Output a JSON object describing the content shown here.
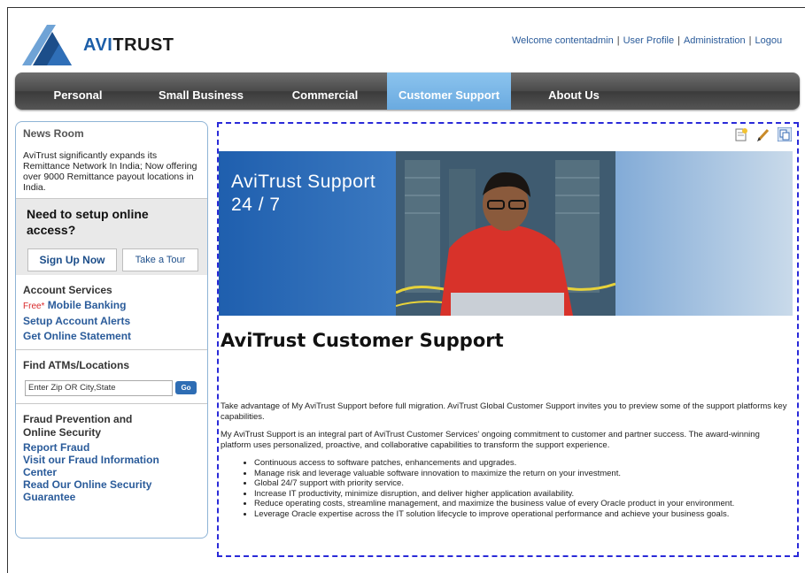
{
  "header": {
    "logo_text_av": "AVI",
    "logo_text_rest": "TRUST",
    "welcome": "Welcome contentadmin",
    "links": [
      "User Profile",
      "Administration",
      "Logou"
    ]
  },
  "nav": {
    "items": [
      "Personal",
      "Small Business",
      "Commercial",
      "Customer Support",
      "About Us"
    ],
    "active": "Customer Support"
  },
  "sidebar": {
    "newsroom": {
      "title": "News Room",
      "text": "AviTrust significantly expands its Remittance Network In India; Now offering over 9000 Remittance payout locations in India."
    },
    "setup": {
      "title": "Need to setup online access?",
      "signup_label": "Sign Up Now",
      "tour_label": "Take a Tour"
    },
    "account": {
      "title": "Account Services",
      "free_tag": "Free*",
      "links": [
        "Mobile Banking",
        "Setup Account Alerts",
        "Get Online Statement"
      ]
    },
    "atm": {
      "title": "Find ATMs/Locations",
      "zip_value": "Enter Zip OR City,State",
      "go_label": "Go"
    },
    "fraud": {
      "title": "Fraud Prevention and Online Security",
      "links": [
        "Report Fraud",
        "Visit our Fraud Information Center",
        "Read Our Online Security Guarantee"
      ]
    }
  },
  "content": {
    "banner_text_1": "AviTrust Support",
    "banner_text_2": "24 / 7",
    "heading": "AviTrust Customer Support",
    "para1": "Take advantage of My AviTrust Support before full migration. AviTrust Global Customer Support invites you to preview some of the support platforms key capabilities.",
    "para2": "My AviTrust Support is an integral part of AviTrust Customer Services' ongoing commitment to customer and partner success. The award-winning platform uses personalized, proactive, and collaborative capabilities to transform the support experience.",
    "bullets": [
      "Continuous access to software patches, enhancements and upgrades.",
      "Manage risk and leverage valuable software innovation to maximize the return on your investment.",
      "Global 24/7 support with priority service.",
      "Increase IT productivity, minimize disruption, and deliver higher application availability.",
      "Reduce operating costs, streamline management, and maximize the business value of every Oracle product in your environment.",
      "Leverage Oracle expertise across the IT solution lifecycle to improve operational performance and achieve your business goals."
    ]
  }
}
